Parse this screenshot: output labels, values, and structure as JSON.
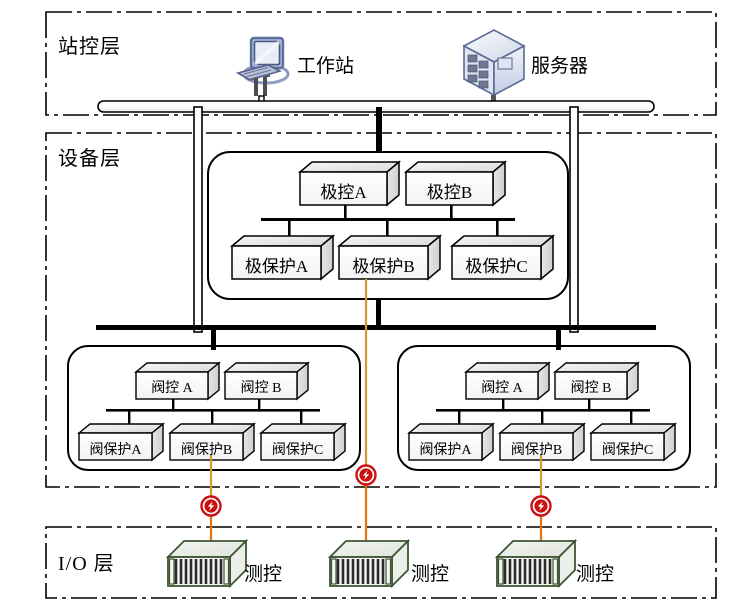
{
  "diagram": {
    "title_implied": "HVDC control and protection system hierarchy",
    "layers": [
      {
        "id": "station",
        "label": "站控层"
      },
      {
        "id": "device",
        "label": "设备层"
      },
      {
        "id": "io",
        "label": "I/O 层"
      }
    ],
    "station_layer": {
      "devices": [
        {
          "id": "workstation",
          "label": "工作站",
          "icon": "workstation-monitor-icon"
        },
        {
          "id": "server",
          "label": "服务器",
          "icon": "server-cube-icon"
        }
      ],
      "bus_name": "station-bus"
    },
    "device_layer": {
      "pole_group": {
        "controllers": [
          {
            "id": "pole-ctrl-a",
            "label": "极控A"
          },
          {
            "id": "pole-ctrl-b",
            "label": "极控B"
          }
        ],
        "protections": [
          {
            "id": "pole-prot-a",
            "label": "极保护A"
          },
          {
            "id": "pole-prot-b",
            "label": "极保护B"
          },
          {
            "id": "pole-prot-c",
            "label": "极保护C"
          }
        ]
      },
      "valve_group_left": {
        "controllers": [
          {
            "id": "valve-ctrl-a-left",
            "label": "阀控 A"
          },
          {
            "id": "valve-ctrl-b-left",
            "label": "阀控 B"
          }
        ],
        "protections": [
          {
            "id": "valve-prot-a-left",
            "label": "阀保护A"
          },
          {
            "id": "valve-prot-b-left",
            "label": "阀保护B"
          },
          {
            "id": "valve-prot-c-left",
            "label": "阀保护C"
          }
        ]
      },
      "valve_group_right": {
        "controllers": [
          {
            "id": "valve-ctrl-a-right",
            "label": "阀控 A"
          },
          {
            "id": "valve-ctrl-b-right",
            "label": "阀控 B"
          }
        ],
        "protections": [
          {
            "id": "valve-prot-a-right",
            "label": "阀保护A"
          },
          {
            "id": "valve-prot-b-right",
            "label": "阀保护B"
          },
          {
            "id": "valve-prot-c-right",
            "label": "阀保护C"
          }
        ]
      }
    },
    "io_layer": {
      "devices": [
        {
          "id": "io-unit-1",
          "label": "测控",
          "icon": "io-rack-icon"
        },
        {
          "id": "io-unit-2",
          "label": "测控",
          "icon": "io-rack-icon"
        },
        {
          "id": "io-unit-3",
          "label": "测控",
          "icon": "io-rack-icon"
        }
      ]
    },
    "link_markers": [
      {
        "id": "optic-marker-1",
        "icon": "fiber-optic-marker-icon"
      },
      {
        "id": "optic-marker-2",
        "icon": "fiber-optic-marker-icon"
      },
      {
        "id": "optic-marker-3",
        "icon": "fiber-optic-marker-icon"
      }
    ],
    "colors": {
      "background": "#ffffff",
      "line": "#000000",
      "fiber_link": "#d59a2b",
      "fiber_link_lower": "#e8720c",
      "marker_red": "#cc1111",
      "box_face": "#ffffff",
      "box_side": "#e0e0e0",
      "box_top": "#ececec",
      "io_rack_border": "#3c5530",
      "io_rack_top": "#e9ece8",
      "monitor_blue": "#7a8ab8",
      "server_blue": "#b9c4de"
    }
  }
}
